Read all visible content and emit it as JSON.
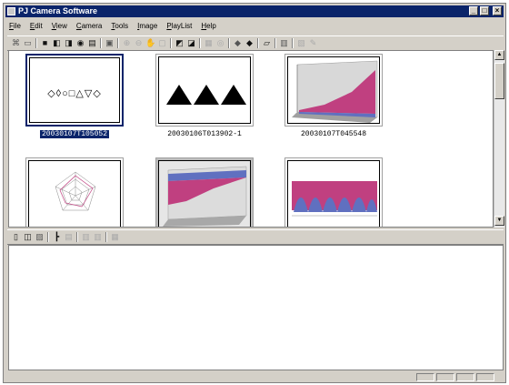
{
  "window": {
    "title": "PJ Camera Software",
    "controls": {
      "minimize": "_",
      "maximize": "□",
      "close": "×"
    }
  },
  "menu": [
    {
      "key": "F",
      "rest": "ile"
    },
    {
      "key": "E",
      "rest": "dit"
    },
    {
      "key": "V",
      "rest": "iew"
    },
    {
      "key": "C",
      "rest": "amera"
    },
    {
      "key": "T",
      "rest": "ools"
    },
    {
      "key": "I",
      "rest": "mage"
    },
    {
      "key": "P",
      "rest": "layList"
    },
    {
      "key": "H",
      "rest": "elp"
    }
  ],
  "toolbar_icons": [
    "capture-icon",
    "camera-icon",
    "open-icon",
    "copy-icon",
    "paste-icon",
    "delete-icon",
    "save-icon",
    "zoom-in-icon",
    "zoom-out-icon",
    "hand-icon",
    "fit-icon",
    "rotate-icon",
    "flip-icon",
    "crop-icon",
    "adjust-icon",
    "prev-icon",
    "next-icon",
    "slideshow-icon",
    "playlist-icon",
    "settings-icon",
    "properties-icon"
  ],
  "thumbnails": [
    {
      "caption": "20030107T105052",
      "selected": true,
      "kind": "shapes",
      "text": "◇◊○□△▽◇"
    },
    {
      "caption": "20030106T013902-1",
      "selected": false,
      "kind": "triangles"
    },
    {
      "caption": "20030107T045548",
      "selected": false,
      "kind": "surface3d"
    },
    {
      "caption": "",
      "selected": false,
      "kind": "radar"
    },
    {
      "caption": "",
      "selected": false,
      "kind": "area3d"
    },
    {
      "caption": "",
      "selected": false,
      "kind": "cones"
    }
  ],
  "toolbar2_icons": [
    "new-list-icon",
    "open-list-icon",
    "save-list-icon",
    "tree-icon",
    "add-icon",
    "move-up-icon",
    "move-down-icon",
    "list-properties-icon"
  ],
  "colors": {
    "selection": "#0a246a",
    "chrome": "#d4d0c8",
    "chart_pink": "#c04080",
    "chart_blue": "#6070c0"
  }
}
